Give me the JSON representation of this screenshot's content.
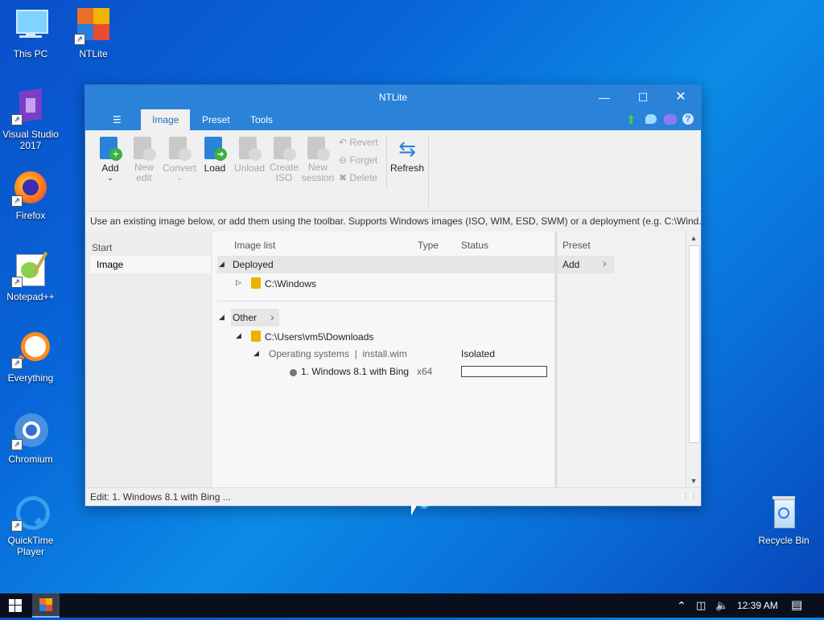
{
  "desktop": {
    "icons": [
      {
        "label": "This PC"
      },
      {
        "label": "NTLite"
      },
      {
        "label": "Visual Studio 2017"
      },
      {
        "label": "Firefox"
      },
      {
        "label": "Notepad++"
      },
      {
        "label": "Everything"
      },
      {
        "label": "Chromium"
      },
      {
        "label": "QuickTime Player"
      },
      {
        "label": "Recycle Bin"
      }
    ]
  },
  "window": {
    "title": "NTLite",
    "menu": {
      "hamburger": "☰",
      "tabs": [
        "Image",
        "Preset",
        "Tools"
      ],
      "active": "Image"
    },
    "toolbar": {
      "add": "Add",
      "new_edit": "New\nedit",
      "convert": "Convert",
      "load": "Load",
      "unload": "Unload",
      "create_iso": "Create\nISO",
      "new_session": "New\nsession",
      "revert": "Revert",
      "forget": "Forget",
      "delete": "Delete",
      "refresh": "Refresh"
    },
    "hint": "Use an existing image below, or add them using the toolbar. Supports Windows images (ISO, WIM, ESD, SWM) or a deployment (e.g. C:\\Wind...",
    "left": {
      "header": "Start",
      "item": "Image"
    },
    "columns": {
      "image_list": "Image list",
      "type": "Type",
      "status": "Status",
      "preset": "Preset"
    },
    "tree": {
      "deployed": "Deployed",
      "windows_path": "C:\\Windows",
      "other": "Other",
      "downloads_path": "C:\\Users\\vm5\\Downloads",
      "os_group": "Operating systems  |  install.wim",
      "os_status": "Isolated",
      "image_name": "1. Windows 8.1 with Bing",
      "image_type": "x64"
    },
    "preset_add": "Add",
    "status_bar": "Edit: 1. Windows 8.1 with Bing ..."
  },
  "taskbar": {
    "time": "12:39 AM"
  },
  "colors": {
    "title_blue": "#2b82d9",
    "accent": "#2b6fb5",
    "taskbar": "#0a0f1e"
  }
}
